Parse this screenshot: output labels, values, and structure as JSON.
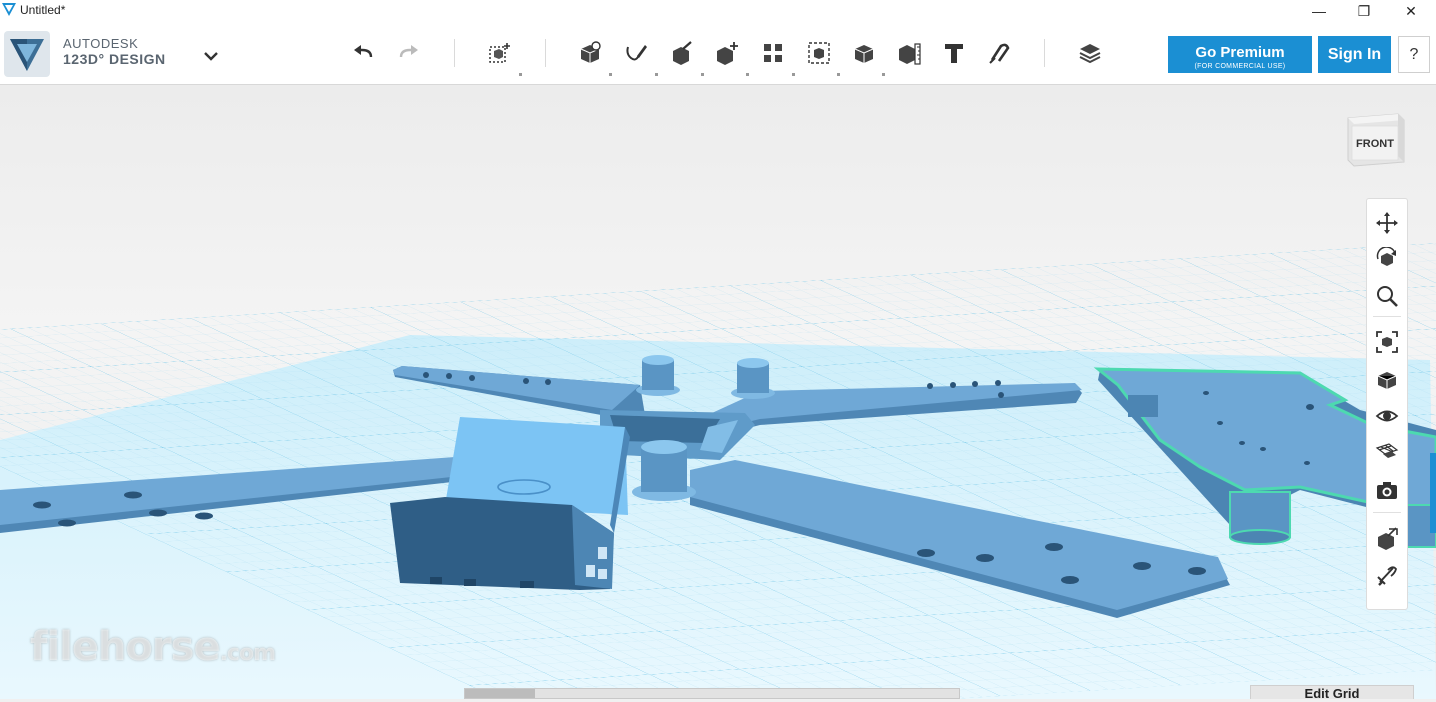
{
  "window": {
    "title": "Untitled*",
    "controls": {
      "minimize": "—",
      "maximize": "❐",
      "close": "✕"
    }
  },
  "brand": {
    "line1": "AUTODESK",
    "line2": "123D° DESIGN",
    "logo_icon": "autodesk-123d-logo",
    "menu_icon": "chevron-down-icon"
  },
  "toolbar": {
    "history": [
      "undo-icon",
      "redo-icon"
    ],
    "transform": [
      "transform-icon"
    ],
    "tools": [
      "primitives-icon",
      "sketch-icon",
      "construct-icon",
      "modify-icon",
      "pattern-icon",
      "grouping-icon",
      "combine-icon",
      "measure-icon",
      "text-icon",
      "snap-icon"
    ],
    "materials": [
      "materials-icon"
    ]
  },
  "account": {
    "premium_label": "Go Premium",
    "premium_sub": "(FOR COMMERCIAL USE)",
    "sign_in": "Sign In",
    "help": "?"
  },
  "viewcube": {
    "face": "FRONT"
  },
  "navigation": [
    "pan-icon",
    "orbit-icon",
    "zoom-icon",
    "fit-icon",
    "view-mode-icon",
    "visibility-icon",
    "grid-material-icon",
    "camera-icon",
    "selection-icon",
    "snapshot-icon"
  ],
  "grid": {
    "edit_label": "Edit Grid"
  },
  "watermark": {
    "brand": "filehorse",
    "suffix": ".com"
  },
  "colors": {
    "accent": "#1b8fd3",
    "part": "#5f9bc9",
    "part_dark": "#3b6f99",
    "part_light": "#8cc7ee",
    "grid": "#bfe8f6",
    "selection_glow": "#4dd9b0"
  }
}
